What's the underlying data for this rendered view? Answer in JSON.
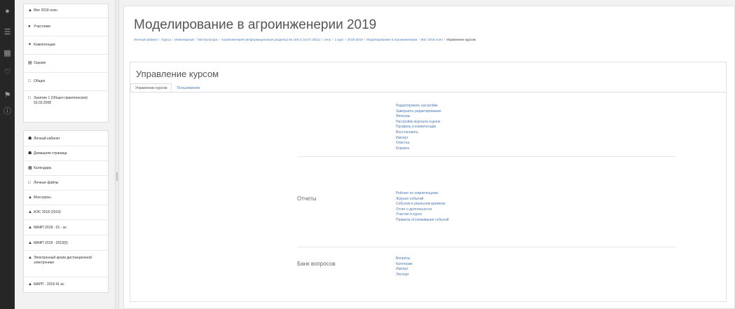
{
  "rail": {
    "icons": [
      "user-icon",
      "list-icon",
      "grid-icon",
      "heart-icon",
      "help-icon"
    ]
  },
  "nav": {
    "group1": [
      {
        "icon": "cap-icon",
        "label": "Мат 2018 осен"
      },
      {
        "icon": "users-icon",
        "label": "Участники"
      },
      {
        "icon": "award-icon",
        "label": "Компетенции"
      },
      {
        "icon": "grades-icon",
        "label": "Оценки"
      },
      {
        "icon": "folder-icon",
        "label": "Общее"
      },
      {
        "icon": "folder-icon",
        "label": "Занятие 1 (Общее практическое) 03.03.2008"
      }
    ],
    "group2": [
      {
        "icon": "home-icon",
        "label": "Личный кабинет"
      },
      {
        "icon": "home-icon",
        "label": "Домашняя страница"
      },
      {
        "icon": "calendar-icon",
        "label": "Календарь"
      },
      {
        "icon": "file-icon",
        "label": "Личные файлы"
      },
      {
        "icon": "cap-icon",
        "label": "Мои курсы"
      },
      {
        "icon": "cap-icon",
        "label": "АЭС 2018 (2019)"
      },
      {
        "icon": "cap-icon",
        "label": "МАФП 2018 - 01 - ас"
      },
      {
        "icon": "cap-icon",
        "label": "МАФП 2018 - 2019(5)"
      },
      {
        "icon": "cap-icon",
        "label": "Электронный архив дистанционной электроники"
      },
      {
        "icon": "cap-icon",
        "label": "МАРП - 2018 41 ас"
      }
    ]
  },
  "main": {
    "title": "Моделирование в агроинженерии 2019",
    "breadcrumb": [
      "Личный кабинет",
      "Курсы",
      "Инженерный",
      "Мат.Культура",
      "Агроинженерия (информационные разделы) № 166 (с 18.07.2021)",
      "очно",
      "1 курс",
      "2018-2019",
      "Моделирование в агроинженерии",
      "Мат 2018 осен",
      "Управление курсом"
    ],
    "section_title": "Управление курсом",
    "tabs": [
      "Управление курсом",
      "Пользователи"
    ],
    "groups": [
      {
        "title": "",
        "links": [
          "Редактировать настройки",
          "Завершить редактирование",
          "Фильтры",
          "Настройки журнала оценок",
          "Профиль и компетенции",
          "Восстановить",
          "Импорт",
          "Очистка",
          "Корзина"
        ]
      },
      {
        "title": "Отчеты",
        "links": [
          "Рейтинг по компетенциям",
          "Журнал событий",
          "События в реальном времени",
          "Отчет о деятельности",
          "Участие в курсе",
          "Правила отслеживания событий"
        ]
      },
      {
        "title": "Банк вопросов",
        "links": [
          "Вопросы",
          "Категории",
          "Импорт",
          "Экспорт"
        ]
      }
    ]
  }
}
